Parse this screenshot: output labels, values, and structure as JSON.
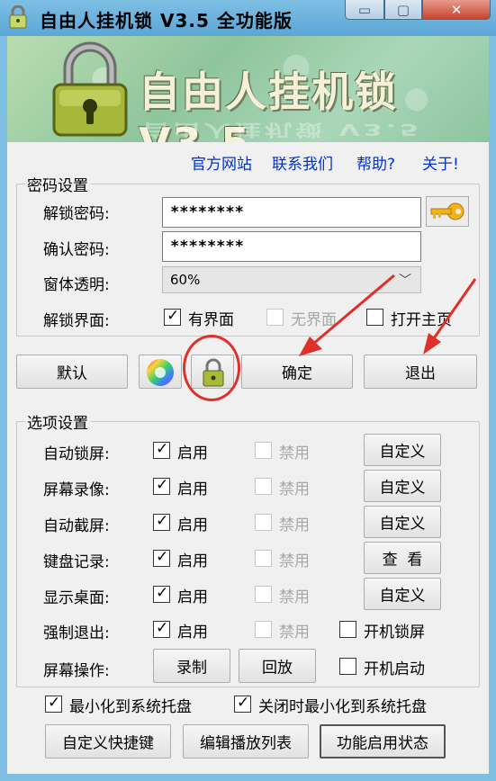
{
  "window": {
    "title": "自由人挂机锁 V3.5 全功能版",
    "banner_title": "自由人挂机锁 V3.5",
    "min_glyph": "▭",
    "max_glyph": "▢",
    "close_glyph": "✕"
  },
  "links": {
    "official_site": "官方网站",
    "contact": "联系我们",
    "help": "帮助?",
    "about": "关于!"
  },
  "password_settings": {
    "group_title": "密码设置",
    "unlock_label": "解锁密码:",
    "unlock_value": "********",
    "confirm_label": "确认密码:",
    "confirm_value": "********",
    "opacity_label": "窗体透明:",
    "opacity_value": "60%",
    "ui_label": "解锁界面:",
    "ui_with": "有界面",
    "ui_without": "无界面",
    "open_home": "打开主页"
  },
  "actions": {
    "default": "默认",
    "confirm": "确定",
    "exit": "退出"
  },
  "options": {
    "group_title": "选项设置",
    "enable": "启用",
    "disable": "禁用",
    "rows": [
      {
        "label": "自动锁屏:",
        "button": "自定义"
      },
      {
        "label": "屏幕录像:",
        "button": "自定义"
      },
      {
        "label": "自动截屏:",
        "button": "自定义"
      },
      {
        "label": "键盘记录:",
        "button": "查  看"
      },
      {
        "label": "显示桌面:",
        "button": "自定义"
      },
      {
        "label": "强制退出:",
        "button": ""
      }
    ],
    "boot_lock": "开机锁屏",
    "screen_ops_label": "屏幕操作:",
    "record": "录制",
    "playback": "回放",
    "boot_start": "开机启动",
    "minimize_tray": "最小化到系统托盘",
    "close_minimize_tray": "关闭时最小化到系统托盘",
    "custom_hotkey": "自定义快捷键",
    "edit_playlist": "编辑播放列表",
    "feature_status": "功能启用状态"
  },
  "colors": {
    "titlebar": "#7fbfe4",
    "link": "#0033cc",
    "annotation_red": "#e0302a"
  }
}
